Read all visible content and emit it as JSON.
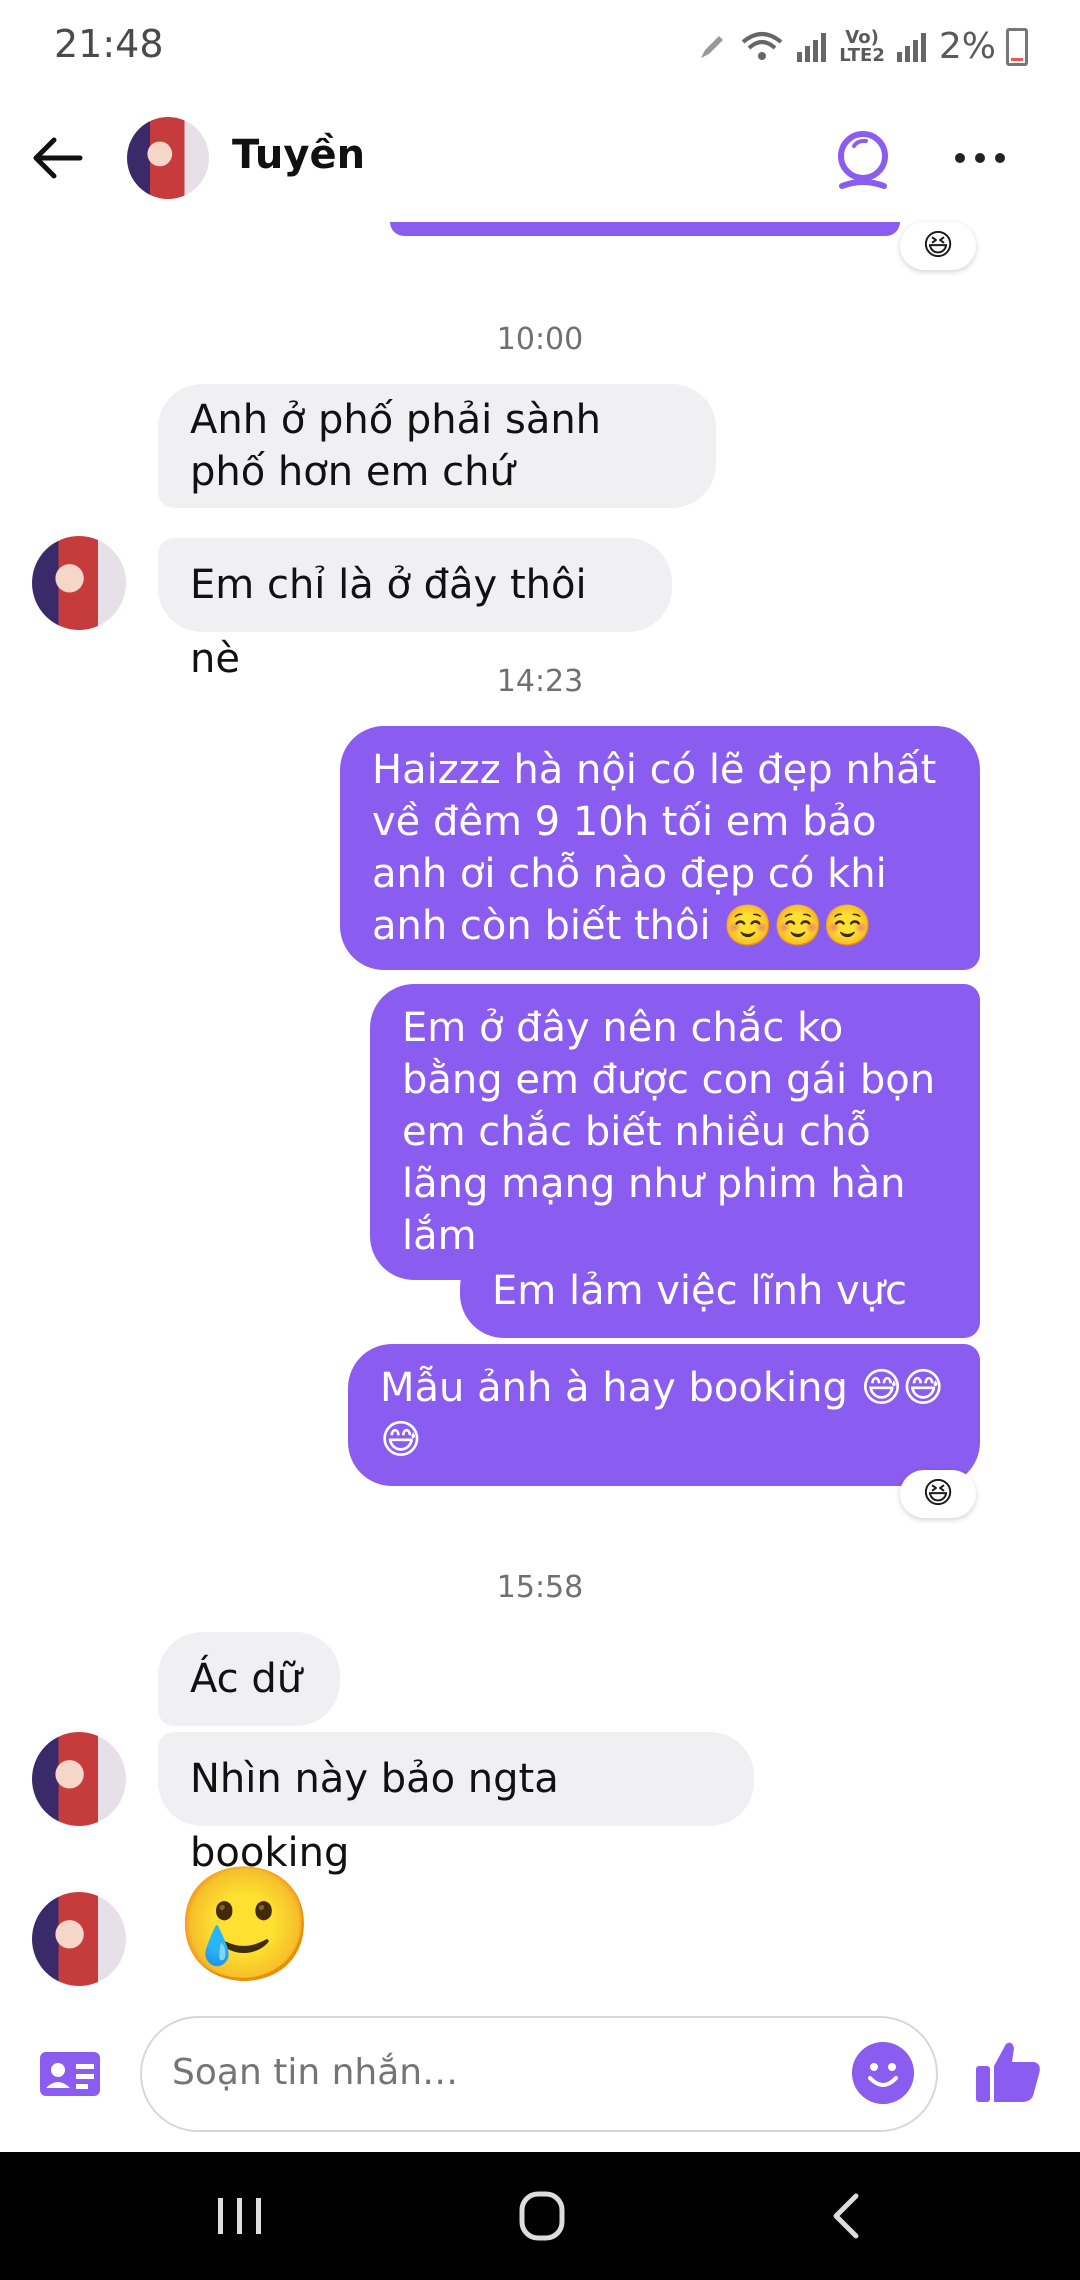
{
  "status": {
    "time": "21:48",
    "volte": "Vo)\nLTE2",
    "battery": "2%"
  },
  "header": {
    "name": "Tuyền"
  },
  "messages": {
    "time1": "10:00",
    "m1": "Anh ở phố phải sành phố hơn em chứ",
    "m2": "Em chỉ là ở đây thôi nè",
    "time2": "14:23",
    "m3": "Haizzz hà nội có lẽ đẹp nhất về đêm 9 10h tối em bảo anh ơi chỗ nào đẹp có khi anh còn biết thôi ☺️☺️☺️",
    "m4": "Em ở đây nên chắc ko bằng em được con gái bọn em chắc biết nhiều chỗ lãng mạng như phim hàn lắm",
    "m5": "Em lảm việc lĩnh vực gì",
    "m6": "Mẫu ảnh à hay booking 😅😅😅",
    "reaction": "😆",
    "time3": "15:58",
    "m7": "Ác dữ",
    "m8": "Nhìn này bảo ngta booking",
    "m9": "🥲"
  },
  "composer": {
    "placeholder": "Soạn tin nhắn…"
  },
  "colors": {
    "accent": "#8b5cf0",
    "incoming": "#f0f0f2"
  },
  "icons": [
    "back-arrow-icon",
    "video-call-icon",
    "more-icon",
    "contact-card-icon",
    "emoji-icon",
    "thumbs-up-icon"
  ]
}
